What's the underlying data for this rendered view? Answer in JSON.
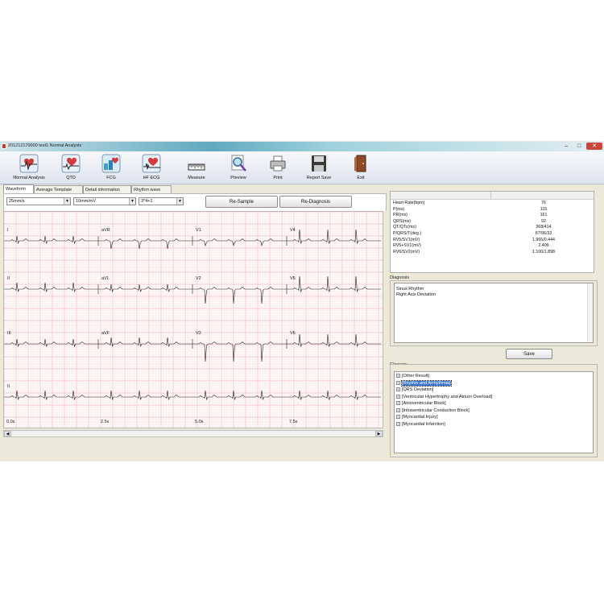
{
  "window": {
    "title": "201212170000  test1  Normal Analysis",
    "controls": {
      "minimize": "–",
      "maximize": "□",
      "close": "✕"
    }
  },
  "toolbar": {
    "items": [
      {
        "label": "Normal Analysis",
        "icon": "ecg-heart-icon"
      },
      {
        "label": "QTD",
        "icon": "qtd-heart-icon"
      },
      {
        "label": "FCG",
        "icon": "fcg-chart-icon"
      },
      {
        "label": "HF ECG",
        "icon": "hf-ecg-icon"
      },
      {
        "label": "Measure",
        "icon": "ruler-icon"
      },
      {
        "label": "Preview",
        "icon": "magnifier-icon"
      },
      {
        "label": "Print",
        "icon": "printer-icon"
      },
      {
        "label": "Report Save",
        "icon": "floppy-disk-icon"
      },
      {
        "label": "Exit",
        "icon": "exit-door-icon"
      }
    ]
  },
  "tabs": [
    "Waveform",
    "Average Template",
    "Detail information",
    "Rhythm wave"
  ],
  "controls": {
    "speed": "25mm/s",
    "gain": "10mm/mV",
    "layout": "3*4+1",
    "resample": "Re-Sample",
    "rediagnosis": "Re-Diagnosis"
  },
  "ecg": {
    "lead_labels": [
      "I",
      "aVR",
      "V1",
      "V4",
      "II",
      "aVL",
      "V2",
      "V5",
      "III",
      "aVF",
      "V3",
      "V6",
      "II"
    ],
    "time_labels": [
      "0.0s",
      "2.5s",
      "5.0s",
      "7.5s"
    ],
    "grid_color": "#f2b8b8",
    "trace_color": "#202020"
  },
  "measurements": [
    {
      "key": "Heart Rate(bpm)",
      "value": "76"
    },
    {
      "key": "P(ms)",
      "value": "115"
    },
    {
      "key": "PR(ms)",
      "value": "161"
    },
    {
      "key": "QRS(ms)",
      "value": "92"
    },
    {
      "key": "QT/QTc(ms)",
      "value": "368/414"
    },
    {
      "key": "P/QRS/T(deg.)",
      "value": "67/96/33"
    },
    {
      "key": "RV5/SV1(mV)",
      "value": "1.965/0.444"
    },
    {
      "key": "RV5+SV1(mV)",
      "value": "2.409"
    },
    {
      "key": "RV6/SV2(mV)",
      "value": "1.100/1.898"
    }
  ],
  "diagnosis": {
    "label": "Diagnosis",
    "lines": [
      "Sinus Rhythm",
      "Right Axis Deviation"
    ]
  },
  "save_button": "Save",
  "glossary": {
    "label": "Glossary",
    "items": [
      {
        "text": "[Other Result]",
        "selected": false
      },
      {
        "text": "[Rhythm and Arrhythmia]",
        "selected": true
      },
      {
        "text": "[QRS Deviation]",
        "selected": false
      },
      {
        "text": "[Ventricular Hypertrophy and Atrium  Overload]",
        "selected": false
      },
      {
        "text": "[Atrioventricular Block]",
        "selected": false
      },
      {
        "text": "[Intraventricular Conduction Block]",
        "selected": false
      },
      {
        "text": "[Myocardial Injury]",
        "selected": false
      },
      {
        "text": "[Myocardial Infarction]",
        "selected": false
      }
    ]
  }
}
